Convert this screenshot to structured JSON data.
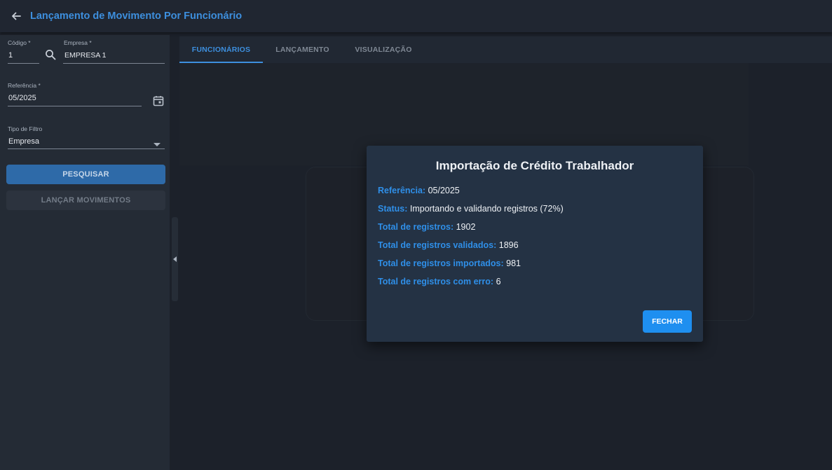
{
  "header": {
    "title": "Lançamento de Movimento Por Funcionário"
  },
  "sidebar": {
    "codigo": {
      "label": "Código *",
      "value": "1"
    },
    "empresa": {
      "label": "Empresa *",
      "value": "EMPRESA 1"
    },
    "referencia": {
      "label": "Referência *",
      "value": "05/2025"
    },
    "tipo_filtro": {
      "label": "Tipo de Filtro",
      "value": "Empresa"
    },
    "pesquisar_label": "PESQUISAR",
    "lancar_label": "LANÇAR MOVIMENTOS"
  },
  "tabs": [
    {
      "label": "FUNCIONÁRIOS",
      "active": true
    },
    {
      "label": "LANÇAMENTO",
      "active": false
    },
    {
      "label": "VISUALIZAÇÃO",
      "active": false
    }
  ],
  "modal": {
    "title": "Importação de Crédito Trabalhador",
    "rows": [
      {
        "key": "Referência:",
        "value": "05/2025"
      },
      {
        "key": "Status:",
        "value": "Importando e validando registros (72%)"
      },
      {
        "key": "Total de registros:",
        "value": "1902"
      },
      {
        "key": "Total de registros validados:",
        "value": "1896"
      },
      {
        "key": "Total de registros importados:",
        "value": "981"
      },
      {
        "key": "Total de registros com erro:",
        "value": "6"
      }
    ],
    "close_label": "FECHAR"
  },
  "icons": {
    "back": "arrow-left-icon",
    "search": "search-icon",
    "calendar": "calendar-icon",
    "dropdown": "caret-down-icon",
    "collapse": "caret-left-icon"
  },
  "colors": {
    "accent": "#3d8fde",
    "modal_key": "#2f8fe8",
    "primary_button": "#1e8ff0",
    "background": "#1c212a"
  }
}
